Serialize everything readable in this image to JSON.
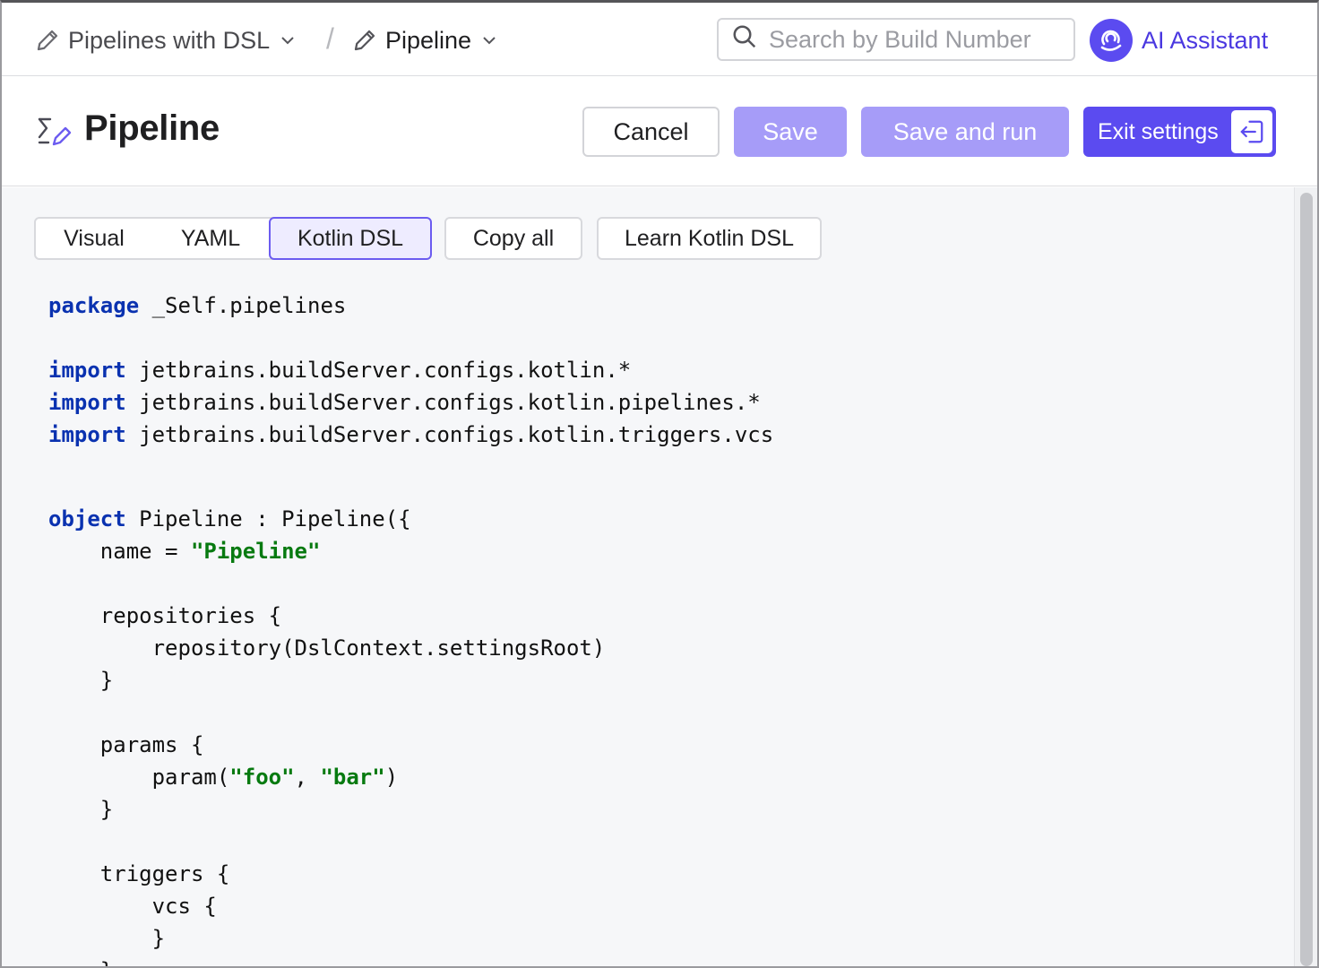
{
  "breadcrumb": {
    "project": "Pipelines with DSL",
    "separator": "/",
    "pipeline": "Pipeline"
  },
  "search": {
    "placeholder": "Search by Build Number"
  },
  "ai_assistant": {
    "label": "AI Assistant"
  },
  "header": {
    "title": "Pipeline",
    "cancel_label": "Cancel",
    "save_label": "Save",
    "save_run_label": "Save and run",
    "exit_label": "Exit settings"
  },
  "tabs": [
    {
      "label": "Visual",
      "active": false
    },
    {
      "label": "YAML",
      "active": false
    },
    {
      "label": "Kotlin DSL",
      "active": true
    }
  ],
  "toolbar": {
    "copy_label": "Copy all",
    "learn_label": "Learn Kotlin DSL"
  },
  "code": {
    "lines": [
      {
        "indent": "",
        "kw": "package",
        "rest": " _Self.pipelines"
      },
      {
        "indent": "",
        "kw": "",
        "rest": ""
      },
      {
        "indent": "",
        "kw": "import",
        "rest": " jetbrains.buildServer.configs.kotlin.*"
      },
      {
        "indent": "",
        "kw": "import",
        "rest": " jetbrains.buildServer.configs.kotlin.pipelines.*"
      },
      {
        "indent": "",
        "kw": "import",
        "rest": " jetbrains.buildServer.configs.kotlin.triggers.vcs"
      },
      {
        "indent": "",
        "kw": "",
        "rest": ""
      },
      {
        "indent": "",
        "kw": "object",
        "rest": " Pipeline : Pipeline({"
      },
      {
        "indent": "    ",
        "pre": "name = ",
        "str": "\"Pipeline\""
      },
      {
        "indent": "",
        "kw": "",
        "rest": ""
      },
      {
        "indent": "    ",
        "kw": "",
        "rest": "repositories {"
      },
      {
        "indent": "        ",
        "kw": "",
        "rest": "repository(DslContext.settingsRoot)"
      },
      {
        "indent": "    ",
        "kw": "",
        "rest": "}"
      },
      {
        "indent": "",
        "kw": "",
        "rest": ""
      },
      {
        "indent": "    ",
        "kw": "",
        "rest": "params {"
      },
      {
        "indent": "        ",
        "pre": "param(",
        "str": "\"foo\"",
        "mid": ", ",
        "str2": "\"bar\"",
        "post": ")"
      },
      {
        "indent": "    ",
        "kw": "",
        "rest": "}"
      },
      {
        "indent": "",
        "kw": "",
        "rest": ""
      },
      {
        "indent": "    ",
        "kw": "",
        "rest": "triggers {"
      },
      {
        "indent": "        ",
        "kw": "",
        "rest": "vcs {"
      },
      {
        "indent": "        ",
        "kw": "",
        "rest": "}"
      },
      {
        "indent": "    ",
        "kw": "",
        "rest": "}"
      }
    ]
  },
  "colors": {
    "accent": "#5b4bf0",
    "accent_disabled": "#a69cf8",
    "keyword": "#0a32b0",
    "string": "#077a10"
  },
  "icons": {
    "breadcrumb": "pencil-icon",
    "search": "search-icon",
    "ai": "ai-assistant-icon",
    "page": "pipeline-edit-icon",
    "exit": "exit-icon",
    "chevron": "chevron-down-icon"
  }
}
